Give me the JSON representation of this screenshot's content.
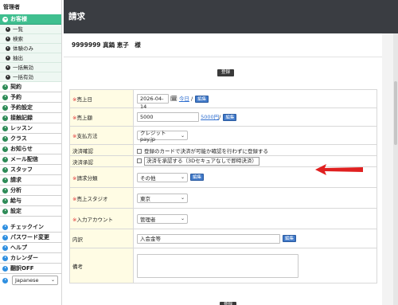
{
  "sidebar": {
    "header": "管理者",
    "customer": {
      "label": "お客様",
      "subitems": [
        "一覧",
        "検索",
        "体験のみ",
        "抽出",
        "一括無効",
        "一括有効"
      ]
    },
    "main_items": [
      "契約",
      "予約",
      "予約設定",
      "接触記録",
      "レッスン",
      "クラス",
      "お知らせ",
      "メール配信",
      "スタッフ",
      "請求",
      "分析",
      "給与",
      "設定"
    ],
    "bottom_items": [
      "チェックイン",
      "パスワード変更",
      "ヘルプ",
      "カレンダー",
      "翻訳OFF"
    ],
    "language": "Japanese"
  },
  "page": {
    "title": "請求",
    "customer_line": "9999999 真鍋 恵子　様",
    "register_label": "登録"
  },
  "form": {
    "required_mark": "※",
    "edit_label": "編集",
    "sales_date": {
      "label": "売上日",
      "value": "2026-04-14",
      "today_link": "今日",
      "sep": "/"
    },
    "amount": {
      "label": "売上額",
      "value": "5000",
      "price_link": "5000円",
      "sep": "/"
    },
    "payment": {
      "label": "支払方法",
      "value": "クレジットpay.jp"
    },
    "confirm": {
      "label": "決済確認",
      "text": "登録のカードで決済が可能か確認を行わずに登録する"
    },
    "approve": {
      "label": "決済承認",
      "text": "決済を承認する（3Dセキュアなしで即時決済）"
    },
    "category": {
      "label": "請求分類",
      "value": "その他"
    },
    "studio": {
      "label": "売上スタジオ",
      "value": "東京"
    },
    "account": {
      "label": "入力アカウント",
      "value": "管理者"
    },
    "detail": {
      "label": "内訳",
      "value": "入会金等"
    },
    "notes": {
      "label": "備考",
      "value": ""
    }
  },
  "colors": {
    "active_green": "#3fbf8f",
    "title_bar": "#3a3d42",
    "label_bg": "#fffce4",
    "required_red": "#e03030",
    "edit_blue": "#3f78c8",
    "arrow_red": "#e02020"
  }
}
